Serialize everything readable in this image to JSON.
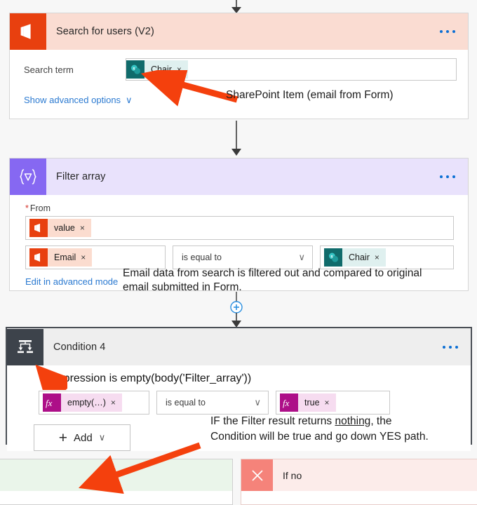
{
  "flow": {
    "steps": [
      {
        "id": "search-for-users",
        "title": "Search for users (V2)",
        "icon": "office365-icon",
        "menu": "more-options",
        "fields": [
          {
            "label": "Search term",
            "token": {
              "text": "Chair",
              "icon": "sharepoint-icon",
              "remove": "×"
            }
          }
        ],
        "advanced_link": "Show advanced options",
        "advanced_chevron": "∨"
      },
      {
        "id": "filter-array",
        "title": "Filter array",
        "icon": "filter-array-icon",
        "from_label": "From",
        "required_marker": "*",
        "from_token": {
          "text": "value",
          "icon": "office365-icon",
          "remove": "×"
        },
        "condition": {
          "left_token": {
            "text": "Email",
            "icon": "office365-icon",
            "remove": "×"
          },
          "operator": "is equal to",
          "operator_chevron": "∨",
          "right_token": {
            "text": "Chair",
            "icon": "sharepoint-icon",
            "remove": "×"
          }
        },
        "advanced_link": "Edit in advanced mode"
      },
      {
        "id": "condition-4",
        "title": "Condition 4",
        "icon": "condition-icon",
        "expression_note": "Expression  is empty(body('Filter_array'))",
        "condition": {
          "left_token": {
            "text": "empty(…)",
            "icon": "fx-icon",
            "remove": "×"
          },
          "operator": "is equal to",
          "operator_chevron": "∨",
          "right_token": {
            "text": "true",
            "icon": "fx-icon",
            "remove": "×"
          }
        },
        "add_button": {
          "plus": "+",
          "label": "Add",
          "chevron": "∨"
        }
      }
    ],
    "branches": [
      {
        "id": "if-yes",
        "label": "",
        "icon": "check-icon"
      },
      {
        "id": "if-no",
        "label": "If no",
        "icon": "x-icon"
      }
    ],
    "connectors": [
      {
        "id": "top-arrow",
        "type": "arrow"
      },
      {
        "id": "search-to-filter",
        "type": "arrow"
      },
      {
        "id": "filter-to-condition",
        "type": "plus-arrow",
        "plus": "+"
      }
    ]
  },
  "annotations": [
    {
      "id": "note-sharepoint-item",
      "text": "SharePoint Item (email from Form)"
    },
    {
      "id": "note-filter-line1",
      "text": "Email data from search is filtered out and compared to original"
    },
    {
      "id": "note-filter-line2",
      "text": "email submitted in Form."
    },
    {
      "id": "note-condition-line1-a",
      "text": "IF the Filter result returns "
    },
    {
      "id": "note-condition-line1-underline",
      "text": "nothing"
    },
    {
      "id": "note-condition-line1-b",
      "text": ", the"
    },
    {
      "id": "note-condition-line2",
      "text": "Condition will be true and go down YES path."
    }
  ],
  "colors": {
    "office365": "#e8400f",
    "sharepoint": "#106b6b",
    "filter_array": "#8668f2",
    "condition": "#3d434b",
    "annotation_arrow": "#f4400d",
    "link": "#2b7ad1",
    "yes_branch": "#eaf5ea",
    "no_branch": "#f5837a"
  }
}
